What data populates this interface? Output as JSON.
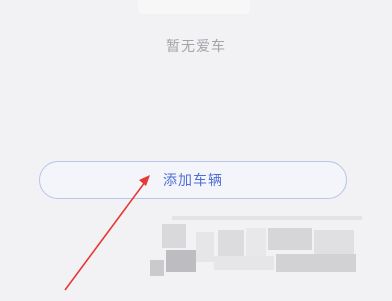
{
  "empty_state": {
    "message": "暂无爱车"
  },
  "actions": {
    "add_vehicle_label": "添加车辆"
  },
  "annotation": {
    "arrow_color": "#e53935"
  },
  "colors": {
    "background": "#f2f2f4",
    "button_border": "#b8c4e8",
    "button_text": "#4f6fd8",
    "muted_text": "#a3a3a9"
  }
}
